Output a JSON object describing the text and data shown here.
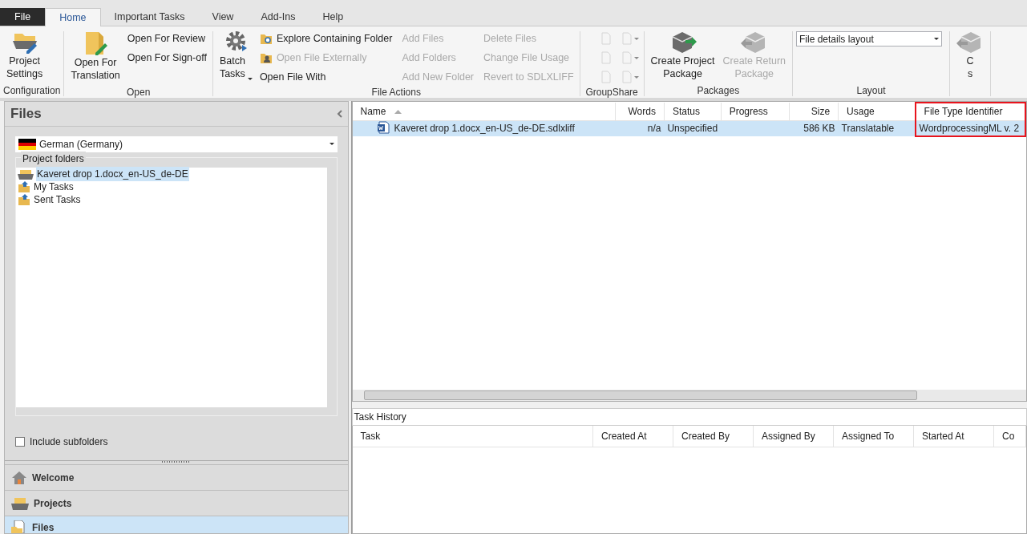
{
  "tabs": [
    {
      "label": "File",
      "kind": "file",
      "selected": false
    },
    {
      "label": "Home",
      "kind": "tab",
      "selected": true
    },
    {
      "label": "Important Tasks",
      "kind": "tab",
      "selected": false
    },
    {
      "label": "View",
      "kind": "tab",
      "selected": false
    },
    {
      "label": "Add-Ins",
      "kind": "tab",
      "selected": false
    },
    {
      "label": "Help",
      "kind": "tab",
      "selected": false
    }
  ],
  "ribbon": {
    "groups": [
      {
        "label": "Configuration",
        "items": [
          {
            "kind": "large",
            "label": "Project\nSettings",
            "disabled": false
          }
        ]
      },
      {
        "label": "Open",
        "items": [
          {
            "kind": "large",
            "label": "Open For\nTranslation",
            "disabled": false
          },
          {
            "kind": "small",
            "label": "Open For Review",
            "disabled": false
          },
          {
            "kind": "small",
            "label": "Open For Sign-off",
            "disabled": false
          }
        ]
      },
      {
        "label": "File Actions",
        "items": [
          {
            "kind": "large",
            "label": "Batch\nTasks",
            "disabled": false,
            "dropdown": true
          },
          {
            "kind": "small",
            "label": "Explore Containing Folder",
            "disabled": false
          },
          {
            "kind": "small",
            "label": "Open File Externally",
            "disabled": true
          },
          {
            "kind": "small",
            "label": "Open File With",
            "disabled": false
          },
          {
            "kind": "small",
            "label": "Add Files",
            "disabled": true
          },
          {
            "kind": "small",
            "label": "Add Folders",
            "disabled": true
          },
          {
            "kind": "small",
            "label": "Add New Folder",
            "disabled": true
          },
          {
            "kind": "small",
            "label": "Delete Files",
            "disabled": true
          },
          {
            "kind": "small",
            "label": "Change File Usage",
            "disabled": true
          },
          {
            "kind": "small",
            "label": "Revert to SDLXLIFF",
            "disabled": true
          }
        ]
      },
      {
        "label": "GroupShare",
        "items": [
          {
            "kind": "icon",
            "disabled": true,
            "dropdown": false
          },
          {
            "kind": "icon",
            "disabled": true,
            "dropdown": false
          },
          {
            "kind": "icon",
            "disabled": true,
            "dropdown": false
          },
          {
            "kind": "icon",
            "disabled": true,
            "dropdown": true
          },
          {
            "kind": "icon",
            "disabled": true,
            "dropdown": true
          },
          {
            "kind": "icon",
            "disabled": true,
            "dropdown": true
          }
        ]
      },
      {
        "label": "Packages",
        "items": [
          {
            "kind": "large",
            "label": "Create Project\nPackage",
            "disabled": false
          },
          {
            "kind": "large",
            "label": "Create Return\nPackage",
            "disabled": true
          }
        ]
      },
      {
        "label": "Layout",
        "items": [
          {
            "kind": "select",
            "value": "File details layout"
          }
        ]
      },
      {
        "items": [
          {
            "kind": "large",
            "label": "C\ns",
            "disabled": false
          }
        ]
      }
    ]
  },
  "files_panel": {
    "title": "Files",
    "language": "German (Germany)",
    "folders_label": "Project folders",
    "tree": [
      {
        "label": "Kaveret drop 1.docx_en-US_de-DE",
        "selected": true
      },
      {
        "label": "My Tasks",
        "selected": false
      },
      {
        "label": "Sent Tasks",
        "selected": false
      }
    ],
    "include_subfolders": {
      "label": "Include subfolders",
      "checked": false
    }
  },
  "nav": [
    {
      "label": "Welcome",
      "selected": false
    },
    {
      "label": "Projects",
      "selected": false
    },
    {
      "label": "Files",
      "selected": true
    }
  ],
  "files_table": {
    "columns": [
      {
        "label": "Name",
        "sorted": true,
        "highlighted": false
      },
      {
        "label": "Words",
        "sorted": false,
        "highlighted": false
      },
      {
        "label": "Status",
        "sorted": false,
        "highlighted": false
      },
      {
        "label": "Progress",
        "sorted": false,
        "highlighted": false
      },
      {
        "label": "Size",
        "sorted": false,
        "highlighted": false
      },
      {
        "label": "Usage",
        "sorted": false,
        "highlighted": false
      },
      {
        "label": "File Type Identifier",
        "sorted": false,
        "highlighted": true
      }
    ],
    "rows": [
      {
        "selected": true,
        "cells": [
          "Kaveret drop 1.docx_en-US_de-DE.sdlxliff",
          "n/a",
          "Unspecified",
          "",
          "586 KB",
          "Translatable",
          "WordprocessingML v. 2"
        ]
      }
    ]
  },
  "task_history": {
    "title": "Task History",
    "columns": [
      "Task",
      "Created At",
      "Created By",
      "Assigned By",
      "Assigned To",
      "Started At",
      "Co"
    ]
  }
}
